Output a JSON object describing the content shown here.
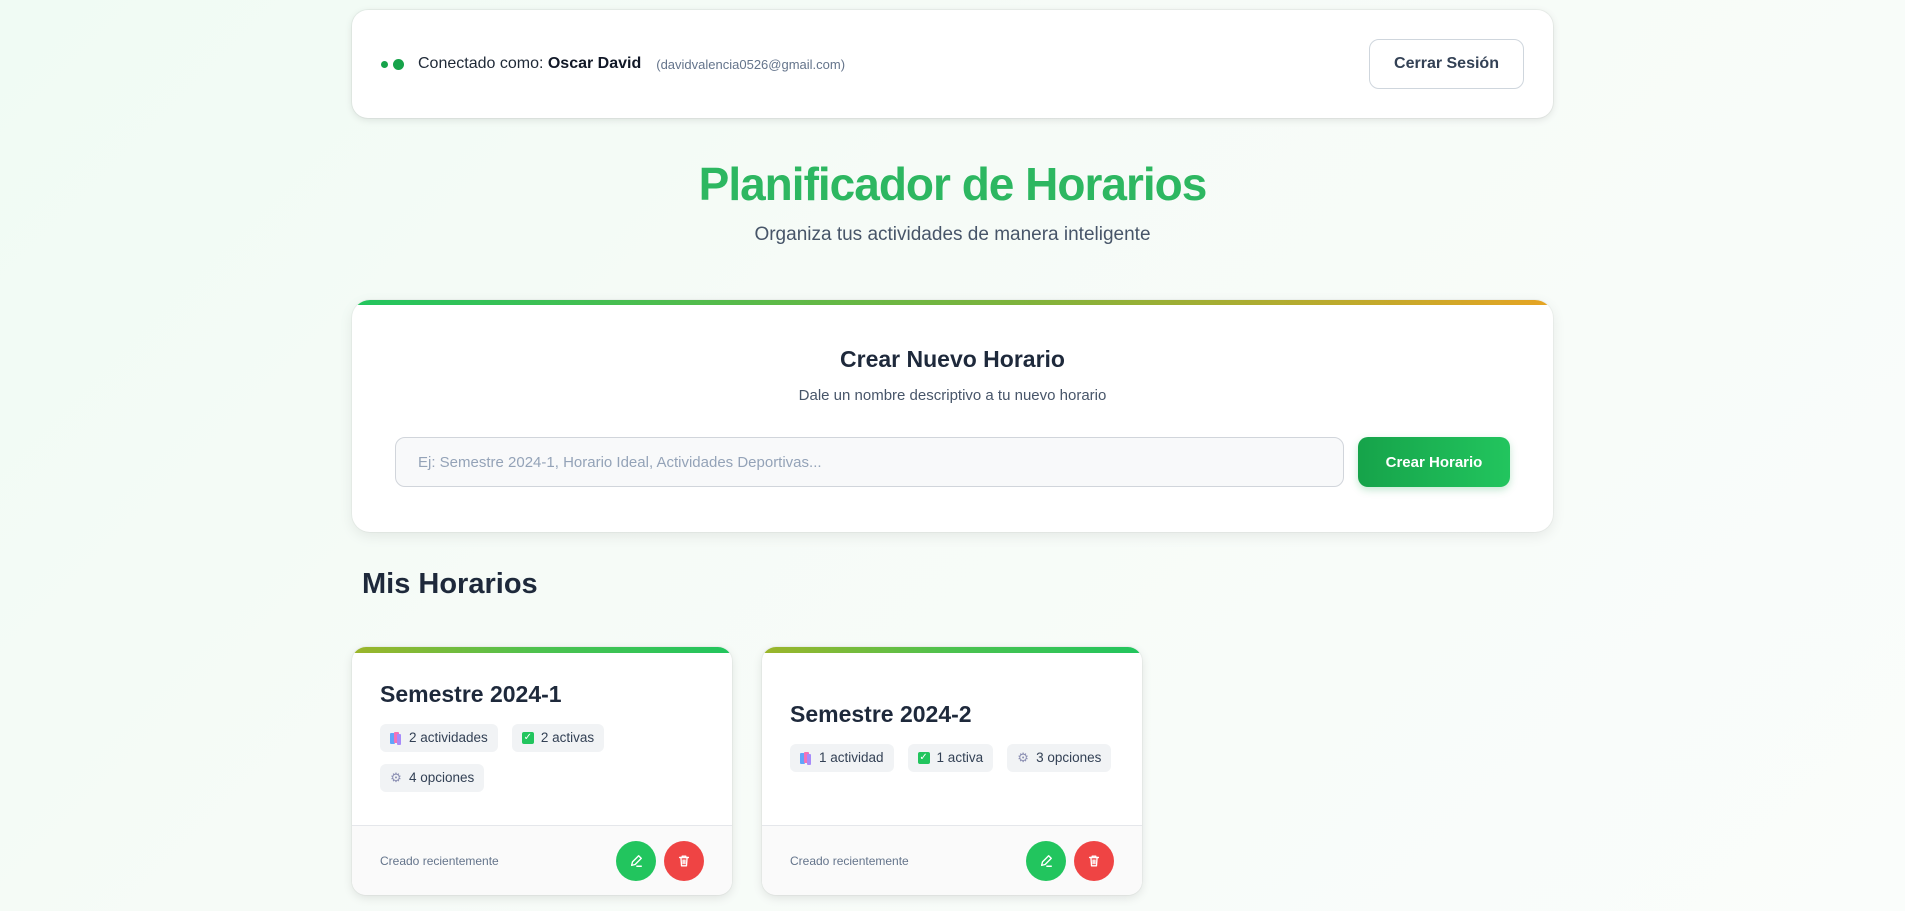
{
  "header": {
    "connected_prefix": "Conectado como:",
    "user_name": "Oscar David",
    "user_email": "(davidvalencia0526@gmail.com)",
    "logout_label": "Cerrar Sesión"
  },
  "hero": {
    "title": "Planificador de Horarios",
    "subtitle": "Organiza tus actividades de manera inteligente"
  },
  "create": {
    "title": "Crear Nuevo Horario",
    "subtitle": "Dale un nombre descriptivo a tu nuevo horario",
    "input_placeholder": "Ej: Semestre 2024-1, Horario Ideal, Actividades Deportivas...",
    "input_value": "",
    "button_label": "Crear Horario"
  },
  "schedules": {
    "heading": "Mis Horarios",
    "items": [
      {
        "name": "Semestre 2024-1",
        "activities": "2 actividades",
        "active": "2 activas",
        "options": "4 opciones",
        "created": "Creado recientemente"
      },
      {
        "name": "Semestre 2024-2",
        "activities": "1 actividad",
        "active": "1 activa",
        "options": "3 opciones",
        "created": "Creado recientemente"
      }
    ]
  },
  "icons": {
    "status": "online-dots-icon",
    "activities": "books-icon",
    "active": "check-box-icon",
    "options": "gear-icon",
    "edit": "pencil-icon",
    "delete": "trash-icon"
  },
  "colors": {
    "brand": "#22c55e",
    "danger": "#ef4444",
    "title_green": "#2db761"
  }
}
